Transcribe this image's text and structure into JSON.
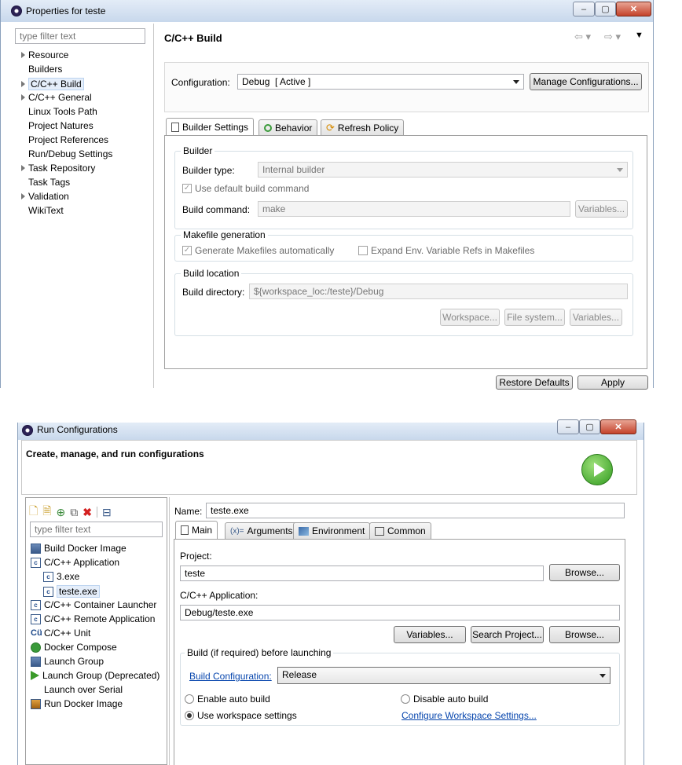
{
  "props_window": {
    "title": "Properties for teste",
    "filter_placeholder": "type filter text",
    "tree": [
      {
        "label": "Resource",
        "expandable": true
      },
      {
        "label": "Builders",
        "expandable": false
      },
      {
        "label": "C/C++ Build",
        "expandable": true,
        "selected": true
      },
      {
        "label": "C/C++ General",
        "expandable": true
      },
      {
        "label": "Linux Tools Path",
        "expandable": false
      },
      {
        "label": "Project Natures",
        "expandable": false
      },
      {
        "label": "Project References",
        "expandable": false
      },
      {
        "label": "Run/Debug Settings",
        "expandable": false
      },
      {
        "label": "Task Repository",
        "expandable": true
      },
      {
        "label": "Task Tags",
        "expandable": false
      },
      {
        "label": "Validation",
        "expandable": true
      },
      {
        "label": "WikiText",
        "expandable": false
      }
    ],
    "page_title": "C/C++ Build",
    "configuration_label": "Configuration:",
    "configuration_value": "Debug  [ Active ]",
    "manage_button": "Manage Configurations...",
    "tabs": [
      "Builder Settings",
      "Behavior",
      "Refresh Policy"
    ],
    "builder_group": "Builder",
    "builder_type_label": "Builder type:",
    "builder_type_value": "Internal builder",
    "use_default_label": "Use default build command",
    "build_command_label": "Build command:",
    "build_command_value": "make",
    "variables_button": "Variables...",
    "makefile_group": "Makefile generation",
    "generate_makefiles_label": "Generate Makefiles automatically",
    "expand_env_label": "Expand Env. Variable Refs in Makefiles",
    "location_group": "Build location",
    "build_directory_label": "Build directory:",
    "build_directory_value": "${workspace_loc:/teste}/Debug",
    "workspace_button": "Workspace...",
    "filesystem_button": "File system...",
    "variables2_button": "Variables...",
    "restore_button": "Restore Defaults",
    "apply_button": "Apply"
  },
  "run_window": {
    "title": "Run Configurations",
    "header": "Create, manage, and run configurations",
    "filter_placeholder": "type filter text",
    "tree": [
      {
        "label": "Build Docker Image",
        "icon": "docker-build-icon",
        "indent": 0
      },
      {
        "label": "C/C++ Application",
        "icon": "c-app-icon",
        "indent": 0
      },
      {
        "label": "3.exe",
        "icon": "c-app-icon",
        "indent": 1
      },
      {
        "label": "teste.exe",
        "icon": "c-app-icon",
        "indent": 1,
        "selected": true
      },
      {
        "label": "C/C++ Container Launcher",
        "icon": "c-app-icon",
        "indent": 0
      },
      {
        "label": "C/C++ Remote Application",
        "icon": "c-app-icon",
        "indent": 0
      },
      {
        "label": "C/C++ Unit",
        "icon": "c-unit-icon",
        "indent": 0
      },
      {
        "label": "Docker Compose",
        "icon": "docker-compose-icon",
        "indent": 0
      },
      {
        "label": "Launch Group",
        "icon": "launch-group-icon",
        "indent": 0
      },
      {
        "label": "Launch Group (Deprecated)",
        "icon": "launch-group-deprecated-icon",
        "indent": 0
      },
      {
        "label": "Launch over Serial",
        "icon": "",
        "indent": 0
      },
      {
        "label": "Run Docker Image",
        "icon": "docker-run-icon",
        "indent": 0
      }
    ],
    "name_label": "Name:",
    "name_value": "teste.exe",
    "tabs": [
      "Main",
      "Arguments",
      "Environment",
      "Common"
    ],
    "project_label": "Project:",
    "project_value": "teste",
    "browse_button": "Browse...",
    "app_label": "C/C++ Application:",
    "app_value": "Debug/teste.exe",
    "variables_button": "Variables...",
    "search_button": "Search Project...",
    "browse2_button": "Browse...",
    "build_group": "Build (if required) before launching",
    "build_config_link": "Build Configuration:",
    "build_config_value": "Release",
    "enable_auto": "Enable auto build",
    "disable_auto": "Disable auto build",
    "use_workspace": "Use workspace settings",
    "configure_link": "Configure Workspace Settings..."
  }
}
